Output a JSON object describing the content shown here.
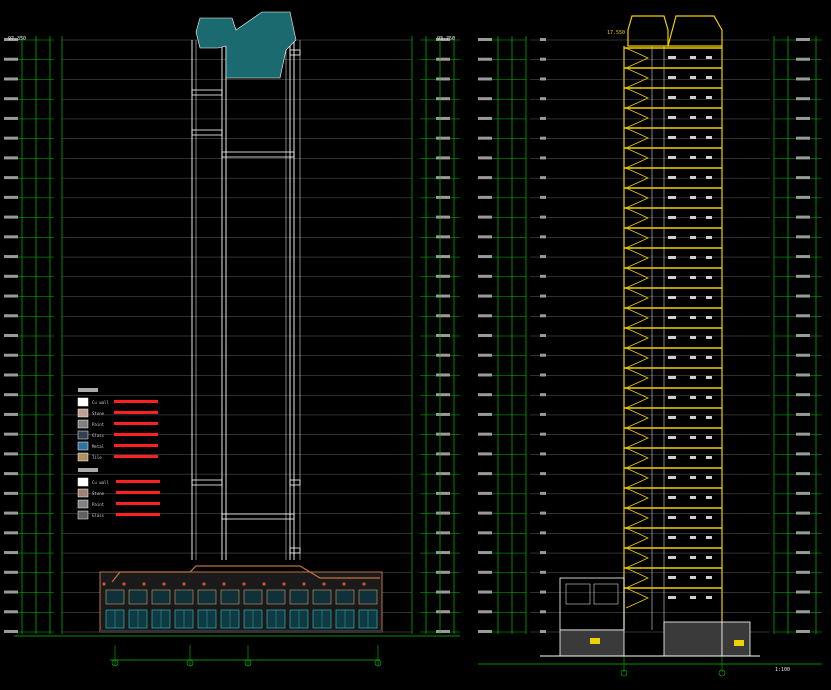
{
  "colors": {
    "background": "#000000",
    "grid": "#00c000",
    "building": "#ffffff",
    "section": "#f0d000",
    "annotation": "#ff2020",
    "roof": "#1a6a70",
    "label": "#e8e8e8",
    "podium": "#c07040"
  },
  "left_elevation": {
    "top_elevations": [
      "97.350",
      "93.750"
    ],
    "legend_group_1": [
      "Cu wall",
      "Stone",
      "Paint",
      "Glass",
      "Metal",
      "Tile"
    ],
    "legend_group_2": [
      "Cu wall",
      "Stone",
      "Paint",
      "Glass"
    ],
    "bottom_markers": [
      "1",
      "2",
      "3",
      "4"
    ]
  },
  "right_section": {
    "top_elevation": "17.550",
    "bottom_markers": [
      "A",
      "B"
    ],
    "scale_note": "1:100"
  }
}
